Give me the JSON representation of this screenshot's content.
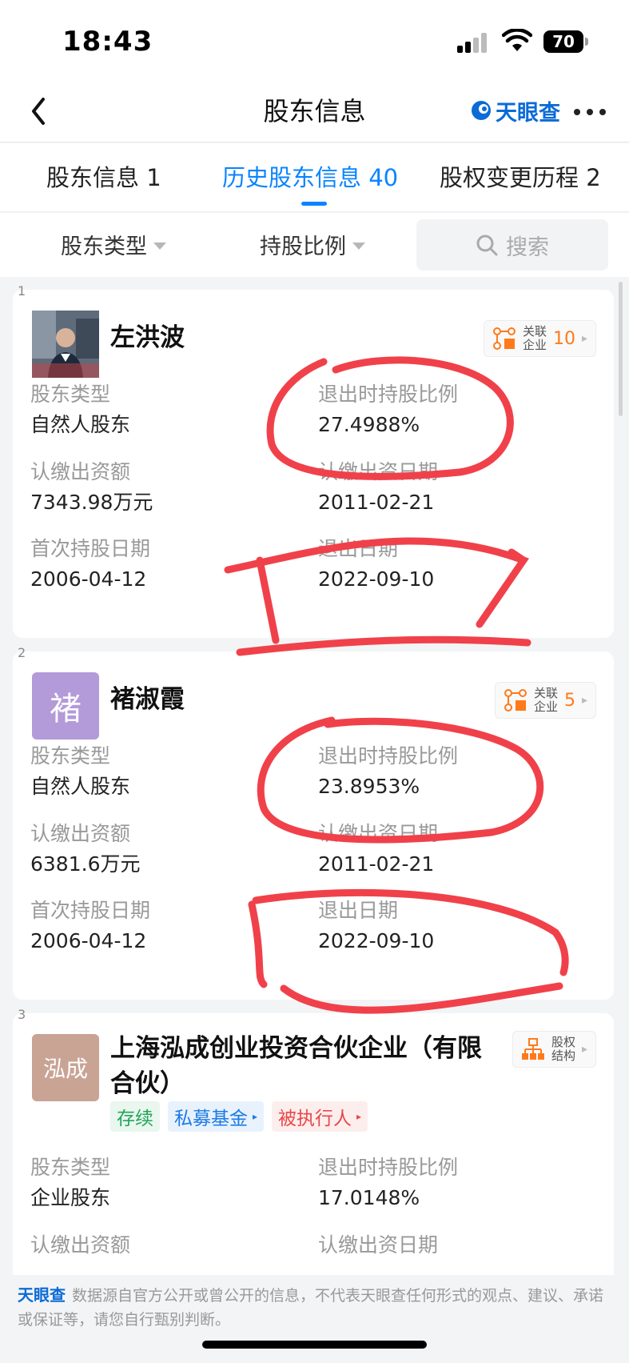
{
  "status_bar": {
    "time": "18:43",
    "battery": "70"
  },
  "nav": {
    "title": "股东信息",
    "brand": "天眼查"
  },
  "tabs": [
    {
      "label": "股东信息 1"
    },
    {
      "label": "历史股东信息 40"
    },
    {
      "label": "股权变更历程 2"
    }
  ],
  "filters": {
    "type_label": "股东类型",
    "ratio_label": "持股比例",
    "search_placeholder": "搜索"
  },
  "cards": [
    {
      "index": "1",
      "name": "左洪波",
      "related": {
        "line1": "关联",
        "line2": "企业",
        "count": "10"
      },
      "fields": [
        {
          "label": "股东类型",
          "value": "自然人股东"
        },
        {
          "label": "退出时持股比例",
          "value": "27.4988%"
        },
        {
          "label": "认缴出资额",
          "value": "7343.98万元"
        },
        {
          "label": "认缴出资日期",
          "value": "2011-02-21"
        },
        {
          "label": "首次持股日期",
          "value": "2006-04-12"
        },
        {
          "label": "退出日期",
          "value": "2022-09-10"
        }
      ]
    },
    {
      "index": "2",
      "name": "褚淑霞",
      "avatar_char": "褚",
      "related": {
        "line1": "关联",
        "line2": "企业",
        "count": "5"
      },
      "fields": [
        {
          "label": "股东类型",
          "value": "自然人股东"
        },
        {
          "label": "退出时持股比例",
          "value": "23.8953%"
        },
        {
          "label": "认缴出资额",
          "value": "6381.6万元"
        },
        {
          "label": "认缴出资日期",
          "value": "2011-02-21"
        },
        {
          "label": "首次持股日期",
          "value": "2006-04-12"
        },
        {
          "label": "退出日期",
          "value": "2022-09-10"
        }
      ]
    },
    {
      "index": "3",
      "name": "上海泓成创业投资合伙企业（有限合伙）",
      "avatar_text": "泓成",
      "structure": {
        "line1": "股权",
        "line2": "结构"
      },
      "tags": [
        "存续",
        "私募基金",
        "被执行人"
      ],
      "fields": [
        {
          "label": "股东类型",
          "value": "企业股东"
        },
        {
          "label": "退出时持股比例",
          "value": "17.0148%"
        },
        {
          "label": "认缴出资额",
          "value": ""
        },
        {
          "label": "认缴出资日期",
          "value": ""
        }
      ]
    }
  ],
  "footer": {
    "brand": "天眼查",
    "note": "数据源自官方公开或曾公开的信息，不代表天眼查任何形式的观点、建议、承诺或保证等，请您自行甄别判断。"
  },
  "colors": {
    "accent": "#0a84ff",
    "annotation": "#f0414a",
    "orange": "#ff7a1a"
  }
}
